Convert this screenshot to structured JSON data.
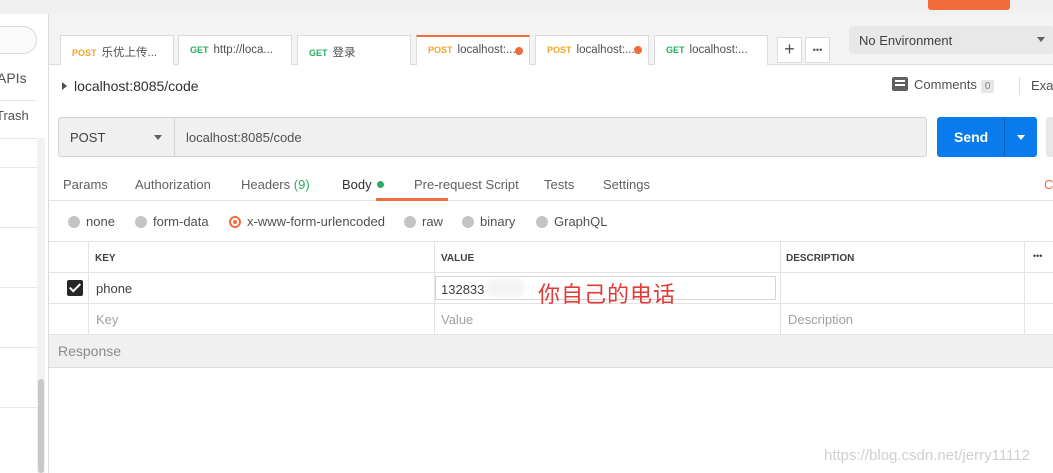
{
  "sidebar": {
    "apis_label": "APIs",
    "trash_label": "Trash"
  },
  "tabs": [
    {
      "method": "POST",
      "label": "乐优上传...",
      "dirty": false
    },
    {
      "method": "GET",
      "label": "http://loca...",
      "dirty": false
    },
    {
      "method": "GET",
      "label": "登录",
      "dirty": false
    },
    {
      "method": "POST",
      "label": "localhost:...",
      "dirty": true,
      "active": true
    },
    {
      "method": "POST",
      "label": "localhost:...",
      "dirty": true
    },
    {
      "method": "GET",
      "label": "localhost:...",
      "dirty": false
    }
  ],
  "tab_actions": {
    "add": "+",
    "more": "•••"
  },
  "environment": {
    "selected": "No Environment"
  },
  "request": {
    "title": "localhost:8085/code",
    "method": "POST",
    "url": "localhost:8085/code",
    "send_label": "Send"
  },
  "comments": {
    "label": "Comments",
    "count": "0"
  },
  "examples_label": "Exa",
  "subtabs": {
    "params": "Params",
    "authorization": "Authorization",
    "headers": "Headers",
    "headers_count": "(9)",
    "body": "Body",
    "prerequest": "Pre-request Script",
    "tests": "Tests",
    "settings": "Settings",
    "clipped": "C"
  },
  "body_types": [
    "none",
    "form-data",
    "x-www-form-urlencoded",
    "raw",
    "binary",
    "GraphQL"
  ],
  "body_type_selected": "x-www-form-urlencoded",
  "table": {
    "headers": {
      "key": "KEY",
      "value": "VALUE",
      "description": "DESCRIPTION",
      "more": "•••"
    },
    "rows": [
      {
        "checked": true,
        "key": "phone",
        "value": "132833",
        "description": ""
      }
    ],
    "placeholders": {
      "key": "Key",
      "value": "Value",
      "description": "Description"
    }
  },
  "annotation": "你自己的电话",
  "response_label": "Response",
  "watermark": "https://blog.csdn.net/jerry11112",
  "colors": {
    "accent": "#f26b3a",
    "send": "#097bed",
    "post": "#f5a623",
    "get": "#27ae60",
    "annotation": "#e53935"
  }
}
